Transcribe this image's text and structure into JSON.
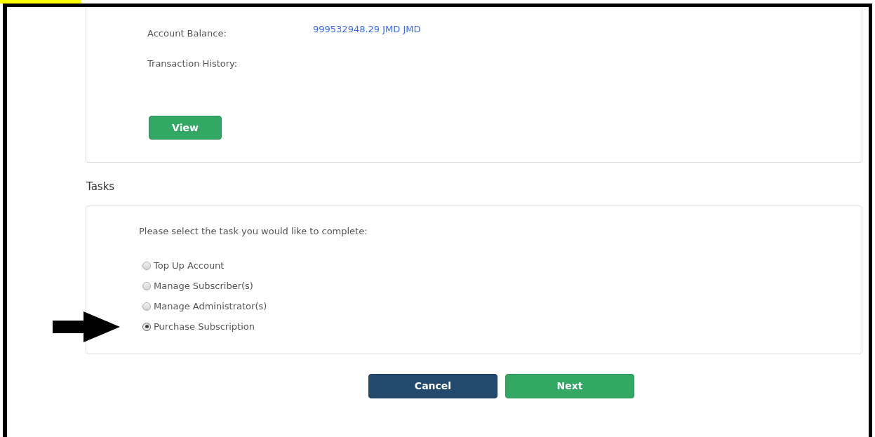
{
  "account": {
    "balance_label": "Account Balance:",
    "balance_value": "999532948.29 JMD JMD",
    "history_label": "Transaction History:",
    "view_button": "View"
  },
  "tasks": {
    "heading": "Tasks",
    "prompt": "Please select the task you would like to complete:",
    "options": [
      {
        "label": "Top Up Account",
        "selected": false
      },
      {
        "label": "Manage Subscriber(s)",
        "selected": false
      },
      {
        "label": "Manage Administrator(s)",
        "selected": false
      },
      {
        "label": "Purchase Subscription",
        "selected": true
      }
    ]
  },
  "buttons": [
    {
      "label": "Cancel",
      "kind": "secondary"
    },
    {
      "label": "Next",
      "kind": "primary"
    }
  ]
}
